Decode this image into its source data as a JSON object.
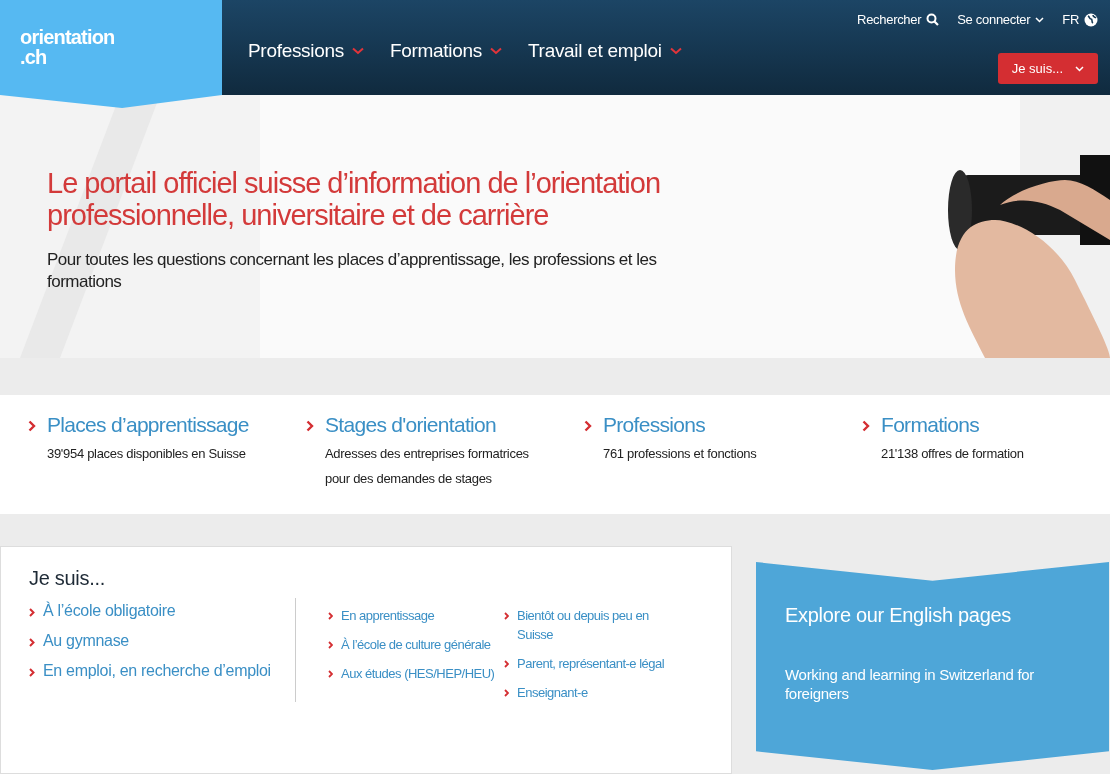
{
  "header": {
    "logo": {
      "line1": "orientation",
      "line2": ".ch"
    },
    "nav": [
      {
        "label": "Professions"
      },
      {
        "label": "Formations"
      },
      {
        "label": "Travail et emploi"
      }
    ],
    "utility": {
      "search": "Rechercher",
      "login": "Se connecter",
      "language": "FR"
    },
    "iam_button": "Je suis..."
  },
  "hero": {
    "kind": "picture",
    "title": "Le portail officiel suisse d’information de l’orientation professionnelle, universitaire et de carrière",
    "subtitle": "Pour toutes les questions concernant les places d’apprentissage, les professions et les formations"
  },
  "quick_links": [
    {
      "title": "Places d’apprentissage",
      "text": "39'954 places disponibles en Suisse"
    },
    {
      "title": "Stages d'orientation",
      "text": "Adresses des entreprises formatrices pour des demandes de stages"
    },
    {
      "title": "Professions",
      "text": "761 professions et fonctions"
    },
    {
      "title": "Formations",
      "text": "21'138 offres de formation"
    }
  ],
  "iam": {
    "heading": "Je suis...",
    "main_links": [
      "À l’école obligatoire",
      "Au gymnase",
      "En emploi, en recherche d’emploi"
    ],
    "column_2": [
      "En apprentissage",
      "À l’école de culture générale",
      "Aux études (HES/HEP/HEU)"
    ],
    "column_3": [
      "Bientôt ou depuis peu en Suisse",
      "Parent, représentant-e légal",
      "Enseignant-e"
    ]
  },
  "english": {
    "title": "Explore our English pages",
    "text": "Working and learning in Switzerland for foreigners"
  }
}
